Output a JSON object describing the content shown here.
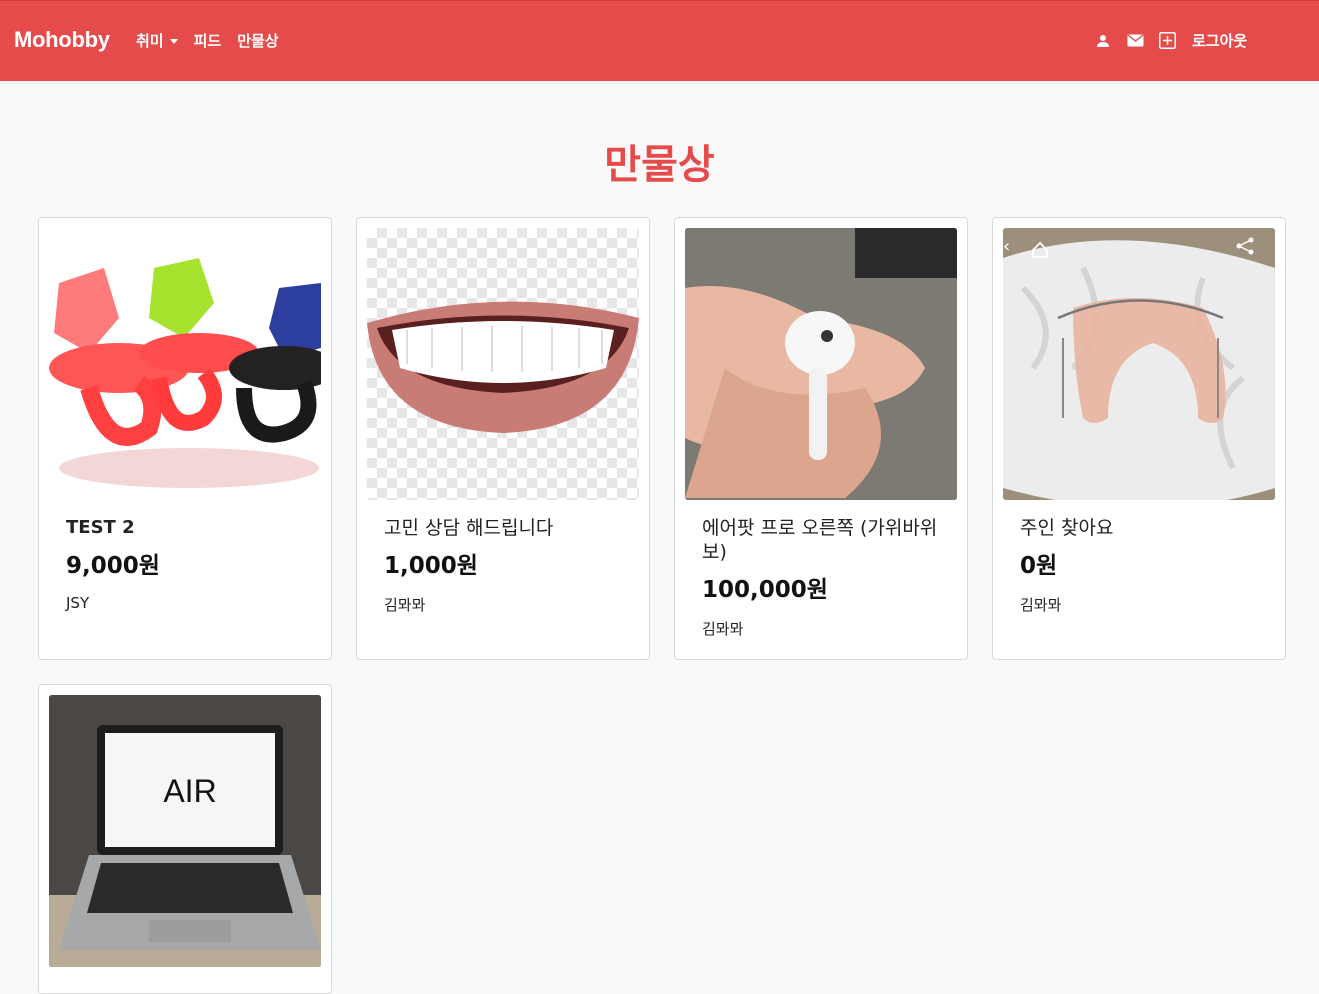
{
  "nav": {
    "brand": "Mohobby",
    "hobby": "취미",
    "feed": "피드",
    "market": "만물상",
    "logout": "로그아웃"
  },
  "page": {
    "title": "만물상"
  },
  "products": [
    {
      "name": "TEST 2",
      "price": "9,000원",
      "seller": "JSY"
    },
    {
      "name": "고민 상담 해드립니다",
      "price": "1,000원",
      "seller": "김뫄뫄"
    },
    {
      "name": "에어팟 프로 오른쪽 (가위바위보)",
      "price": "100,000원",
      "seller": "김뫄뫄"
    },
    {
      "name": "주인 찾아요",
      "price": "0원",
      "seller": "김뫄뫄"
    },
    {
      "name": "",
      "price": "",
      "seller": "",
      "image_text": "AIR"
    }
  ],
  "colors": {
    "accent": "#e54b4b",
    "background": "#f8f9f8"
  }
}
